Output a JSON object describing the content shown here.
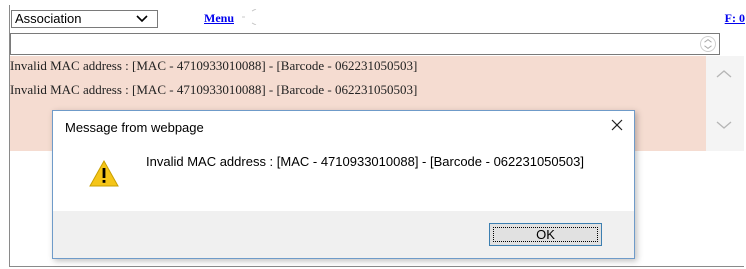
{
  "toolbar": {
    "select_value": "Association",
    "menu_label": "Menu",
    "f_label": "F: 0"
  },
  "errors": {
    "lines": [
      "Invalid MAC address : [MAC - 4710933010088] - [Barcode - 062231050503]",
      "Invalid MAC address : [MAC - 4710933010088] - [Barcode - 062231050503]"
    ]
  },
  "dialog": {
    "title": "Message from webpage",
    "message": "Invalid MAC address : [MAC - 4710933010088] - [Barcode - 062231050503]",
    "ok_label": "OK"
  },
  "colors": {
    "error_bg": "#f5dcd1",
    "link": "#0000ee",
    "dialog_border": "#6f9bc9",
    "warning": "#f5c518"
  },
  "icons": {
    "select_chevron": "chevron-down-icon",
    "input_spin": "spinner-icon",
    "scroll_up": "chevron-up-icon",
    "scroll_down": "chevron-down-icon",
    "dialog_close": "close-icon",
    "dialog_warning": "warning-icon"
  }
}
